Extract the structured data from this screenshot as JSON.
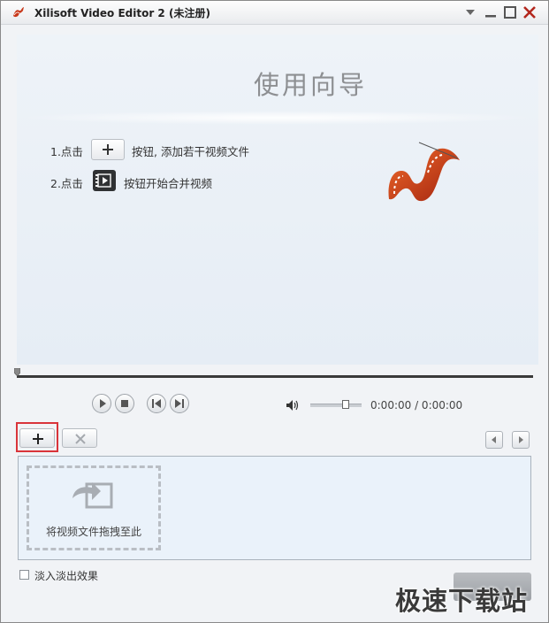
{
  "window": {
    "title": "Xilisoft Video Editor 2 (未注册)",
    "minimize_label": "",
    "controls": [
      "menu-arrow-icon",
      "minimize-icon",
      "maximize-icon",
      "close-icon"
    ]
  },
  "wizard": {
    "title": "使用向导",
    "step1_prefix": "1.点击",
    "step1_suffix": "按钮, 添加若干视频文件",
    "step2_prefix": "2.点击",
    "step2_suffix": "按钮开始合并视频"
  },
  "player": {
    "time": "0:00:00 / 0:00:00",
    "volume_level": 0.7,
    "progress": 0
  },
  "clips": {
    "drop_hint": "将视频文件拖拽至此"
  },
  "options": {
    "fade_label": "淡入淡出效果",
    "fade_checked": false
  },
  "watermark": {
    "text": "极速下载站"
  },
  "colors": {
    "highlight_frame": "#d9343a",
    "logo_red": "#c8381a",
    "clip_area_bg": "#eaf2fa"
  }
}
